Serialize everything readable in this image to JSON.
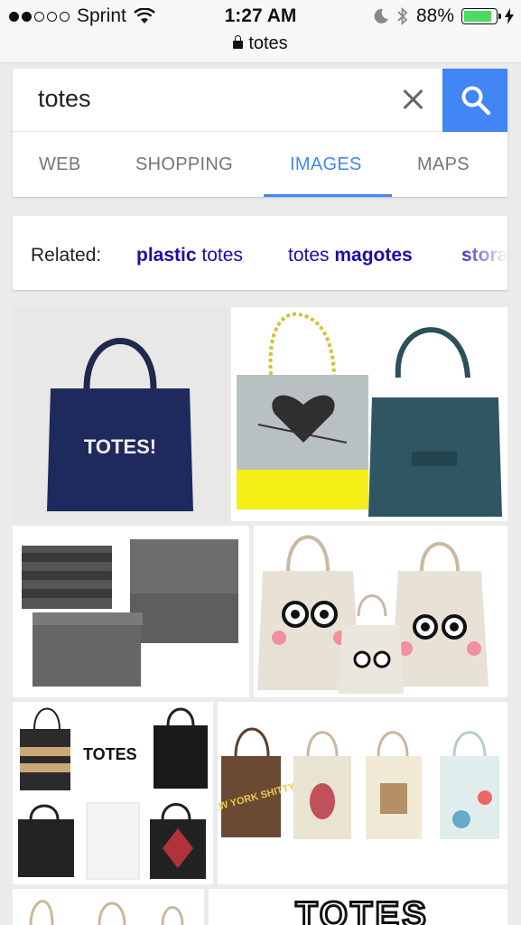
{
  "status_bar": {
    "carrier": "Sprint",
    "time": "1:27 AM",
    "battery_percent": "88%",
    "battery_level": 0.88,
    "url": "totes"
  },
  "search": {
    "query": "totes",
    "accent": "#4285f4"
  },
  "tabs": [
    {
      "label": "WEB",
      "active": false
    },
    {
      "label": "SHOPPING",
      "active": false
    },
    {
      "label": "IMAGES",
      "active": true
    },
    {
      "label": "MAPS",
      "active": false
    }
  ],
  "related": {
    "label": "Related:",
    "chips": [
      {
        "bold": "plastic",
        "rest": " totes"
      },
      {
        "pre": "totes ",
        "bold": "magotes"
      },
      {
        "bold": "stora"
      }
    ]
  },
  "images": [
    {
      "caption": "TOTES!"
    },
    {
      "caption": ""
    },
    {
      "caption": ""
    },
    {
      "caption": ""
    },
    {
      "caption": "TOTES"
    },
    {
      "caption": "NEW YORK SHITTY"
    },
    {
      "caption": ""
    },
    {
      "caption": "TOTES"
    }
  ],
  "icons": [
    "signal-dots-icon",
    "wifi-icon",
    "moon-icon",
    "bluetooth-icon",
    "battery-icon",
    "charging-icon",
    "lock-icon",
    "clear-icon",
    "search-icon"
  ]
}
